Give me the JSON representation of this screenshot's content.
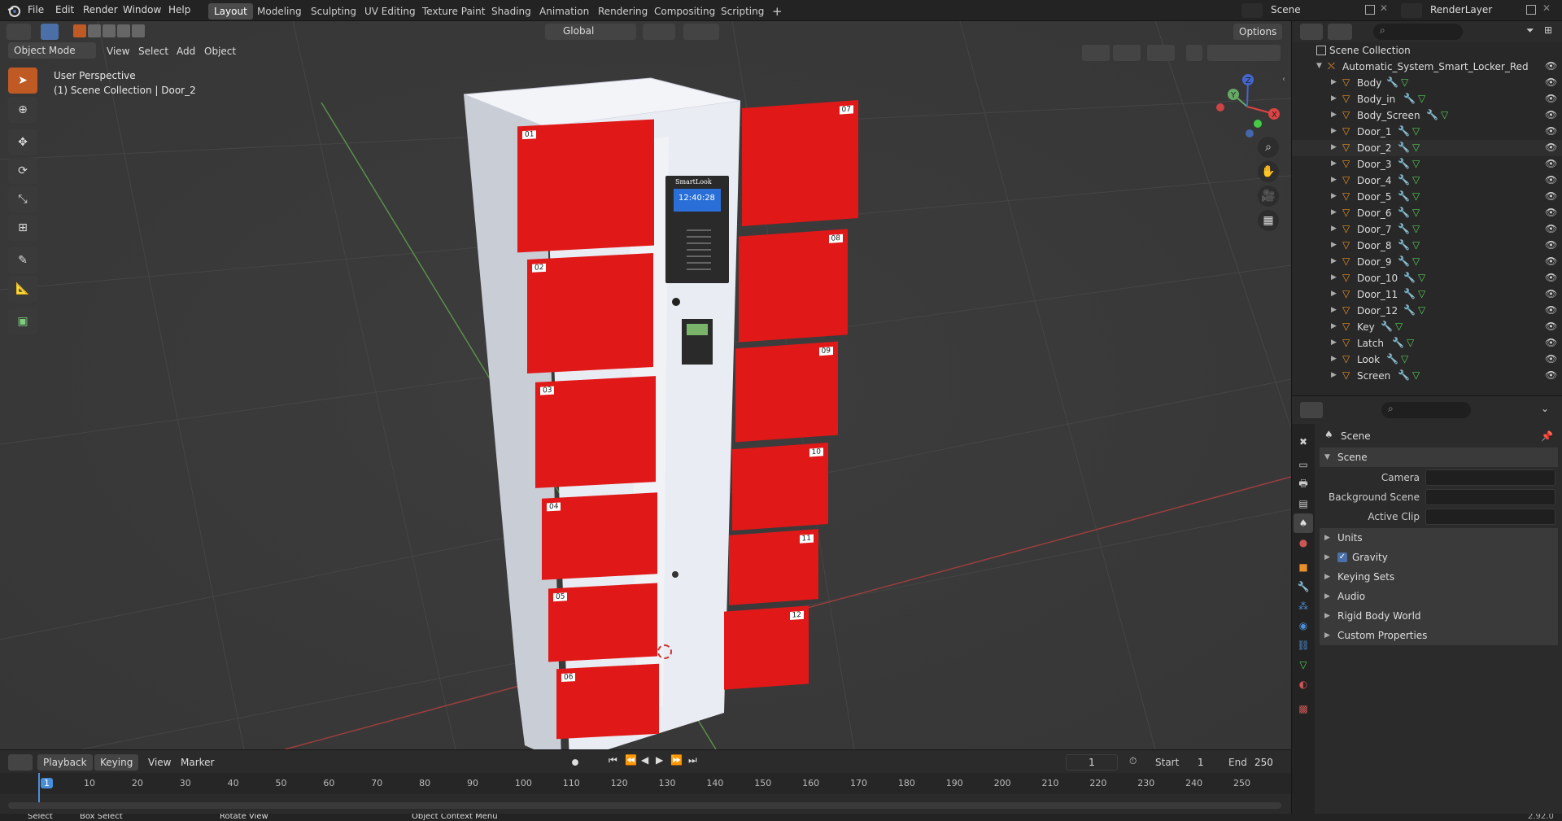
{
  "topbar": {
    "menus": [
      "File",
      "Edit",
      "Render",
      "Window",
      "Help"
    ],
    "workspaces": [
      "Layout",
      "Modeling",
      "Sculpting",
      "UV Editing",
      "Texture Paint",
      "Shading",
      "Animation",
      "Rendering",
      "Compositing",
      "Scripting"
    ],
    "active_workspace": "Layout",
    "add_tab": "+",
    "scene": "Scene",
    "view_layer": "RenderLayer"
  },
  "viewport": {
    "mode": "Object Mode",
    "menus": [
      "View",
      "Select",
      "Add",
      "Object"
    ],
    "transform_orientation": "Global",
    "options": "Options",
    "overlay_line1": "User Perspective",
    "overlay_line2": "(1) Scene Collection | Door_2",
    "gizmo": {
      "x": "X",
      "y": "Y",
      "z": "Z"
    }
  },
  "locker": {
    "brand": "SmartLook",
    "clock": "12:40:28",
    "left_doors": [
      "01",
      "02",
      "03",
      "04",
      "05",
      "06"
    ],
    "right_doors": [
      "07",
      "08",
      "09",
      "10",
      "11",
      "12"
    ]
  },
  "outliner": {
    "root": "Scene Collection",
    "collection": "Automatic_System_Smart_Locker_Red",
    "items": [
      "Body",
      "Body_in",
      "Body_Screen",
      "Door_1",
      "Door_2",
      "Door_3",
      "Door_4",
      "Door_5",
      "Door_6",
      "Door_7",
      "Door_8",
      "Door_9",
      "Door_10",
      "Door_11",
      "Door_12",
      "Key",
      "Latch",
      "Look",
      "Screen"
    ],
    "selected": "Door_2"
  },
  "properties": {
    "header": "Scene",
    "section": "Scene",
    "fields": [
      {
        "label": "Camera"
      },
      {
        "label": "Background Scene"
      },
      {
        "label": "Active Clip"
      }
    ],
    "collapsed": [
      "Units",
      "Gravity",
      "Keying Sets",
      "Audio",
      "Rigid Body World",
      "Custom Properties"
    ],
    "gravity_checked": true
  },
  "timeline": {
    "menus": [
      "Playback",
      "Keying",
      "View",
      "Marker"
    ],
    "current_frame": "1",
    "start_label": "Start",
    "start": "1",
    "end_label": "End",
    "end": "250",
    "ruler": [
      "1",
      "10",
      "20",
      "30",
      "40",
      "50",
      "60",
      "70",
      "80",
      "90",
      "100",
      "110",
      "120",
      "130",
      "140",
      "150",
      "160",
      "170",
      "180",
      "190",
      "200",
      "210",
      "220",
      "230",
      "240",
      "250"
    ]
  },
  "statusbar": {
    "items": [
      "Select",
      "Box Select",
      "Rotate View",
      "Object Context Menu"
    ],
    "version": "2.92.0"
  },
  "colors": {
    "accent": "#4b70a8",
    "selection": "#c05a24",
    "locker_red": "#e01818",
    "locker_body": "#e9ecf2"
  }
}
